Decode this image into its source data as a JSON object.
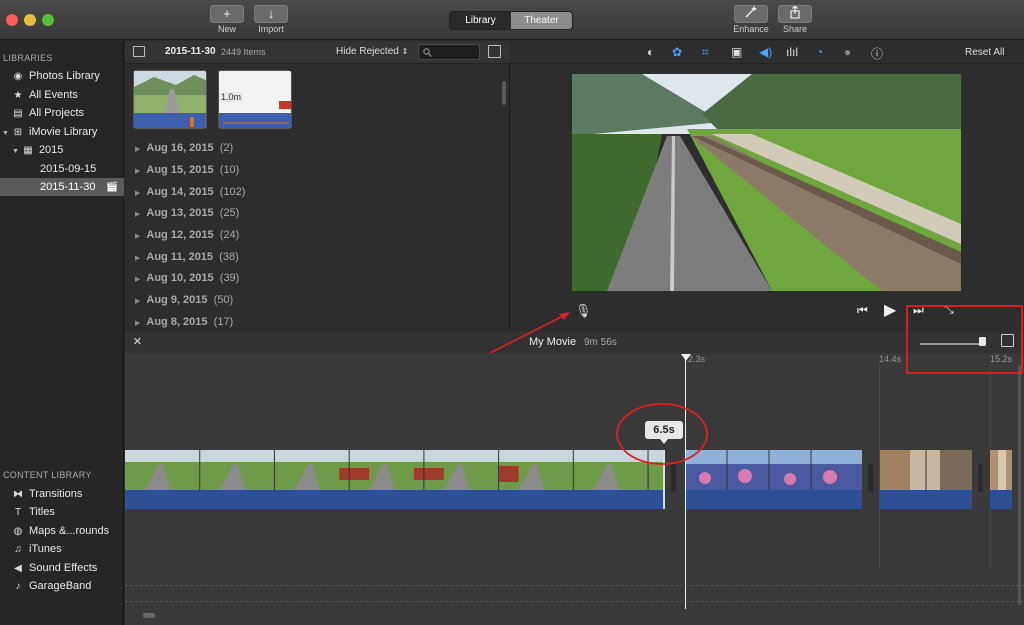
{
  "toolbar": {
    "new_label": "New",
    "import_label": "Import",
    "tab_library": "Library",
    "tab_theater": "Theater",
    "enhance_label": "Enhance",
    "share_label": "Share",
    "new_glyph": "+",
    "import_glyph": "↓"
  },
  "sidebar": {
    "libraries_header": "LIBRARIES",
    "items": [
      {
        "label": "Photos Library",
        "icon": "photos-icon"
      },
      {
        "label": "All Events",
        "icon": "star-icon"
      },
      {
        "label": "All Projects",
        "icon": "projects-icon"
      },
      {
        "label": "iMovie Library",
        "icon": "grid-icon"
      },
      {
        "label": "2015",
        "icon": "calendar-icon"
      },
      {
        "label": "2015-09-15",
        "icon": ""
      },
      {
        "label": "2015-11-30",
        "icon": "clapper-icon"
      }
    ],
    "content_header": "CONTENT LIBRARY",
    "content_items": [
      {
        "label": "Transitions",
        "icon": "transitions-icon"
      },
      {
        "label": "Titles",
        "icon": "titles-icon"
      },
      {
        "label": "Maps &...rounds",
        "icon": "globe-icon"
      },
      {
        "label": "iTunes",
        "icon": "music-note-icon"
      },
      {
        "label": "Sound Effects",
        "icon": "speaker-icon"
      },
      {
        "label": "GarageBand",
        "icon": "guitar-icon"
      }
    ]
  },
  "browser": {
    "event_title": "2015-11-30",
    "item_count": "2449 Items",
    "filter": "Hide Rejected",
    "thumb_duration": "1.0m",
    "dates": [
      {
        "date": "Aug 16, 2015",
        "count": "(2)"
      },
      {
        "date": "Aug 15, 2015",
        "count": "(10)"
      },
      {
        "date": "Aug 14, 2015",
        "count": "(102)"
      },
      {
        "date": "Aug 13, 2015",
        "count": "(25)"
      },
      {
        "date": "Aug 12, 2015",
        "count": "(24)"
      },
      {
        "date": "Aug 11, 2015",
        "count": "(38)"
      },
      {
        "date": "Aug 10, 2015",
        "count": "(39)"
      },
      {
        "date": "Aug 9, 2015",
        "count": "(50)"
      },
      {
        "date": "Aug 8, 2015",
        "count": "(17)"
      }
    ]
  },
  "viewer": {
    "reset_all": "Reset All"
  },
  "timeline": {
    "title": "My Movie",
    "duration": "9m 56s",
    "ticks": [
      "2.3s",
      "14.4s",
      "15.2s"
    ],
    "clip_tooltip": "6.5s"
  },
  "colors": {
    "accent_blue": "#4aa3ff",
    "audio_blue": "#2c4f96",
    "annotation_red": "#e02020"
  }
}
